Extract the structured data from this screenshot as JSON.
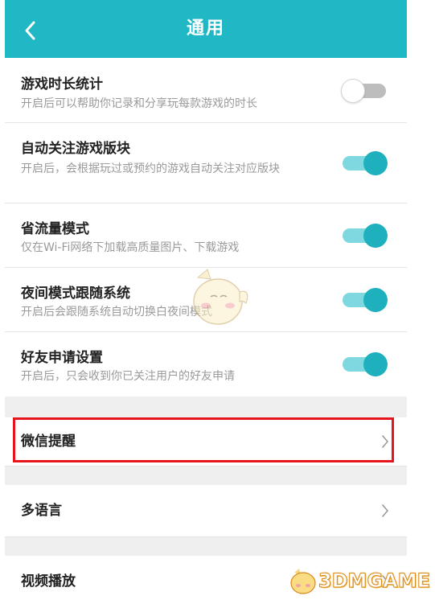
{
  "header": {
    "title": "通用",
    "back_icon": "chevron-left-icon"
  },
  "settings": [
    {
      "title": "游戏时长统计",
      "desc": "开启后可以帮助你记录和分享玩每款游戏的时长",
      "enabled": false
    },
    {
      "title": "自动关注游戏版块",
      "desc": "开启后，会根据玩过或预约的游戏自动关注对应版块",
      "enabled": true
    },
    {
      "title": "省流量模式",
      "desc": "仅在Wi-Fi网络下加载高质量图片、下载游戏",
      "enabled": true
    },
    {
      "title": "夜间模式跟随系统",
      "desc": "开启后会跟随系统自动切换白夜间模式",
      "enabled": true
    },
    {
      "title": "好友申请设置",
      "desc": "开启后，只会收到你已关注用户的好友申请",
      "enabled": true
    }
  ],
  "links": [
    {
      "label": "微信提醒",
      "highlighted": true
    },
    {
      "label": "多语言"
    },
    {
      "label": "视频播放"
    }
  ],
  "watermark": {
    "text": "3DMGAME"
  },
  "colors": {
    "accent": "#1fb8c4",
    "toggle_on": "#1fb0bd",
    "highlight": "#e8141c"
  }
}
